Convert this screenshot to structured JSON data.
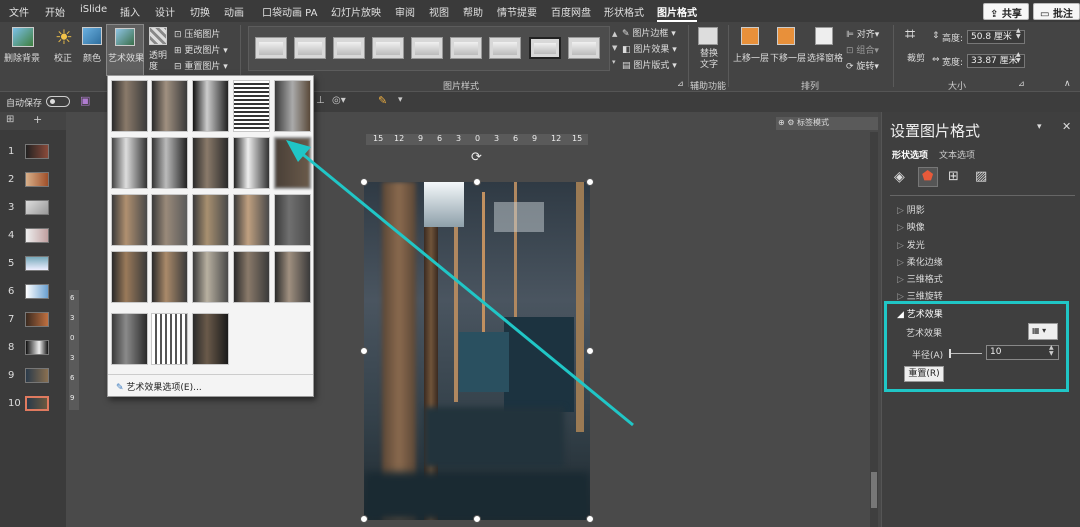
{
  "menubar": {
    "tabs": [
      "文件",
      "开始",
      "iSlide",
      "插入",
      "设计",
      "切换",
      "动画",
      "口袋动画 PA",
      "幻灯片放映",
      "审阅",
      "视图",
      "帮助",
      "情节提要",
      "百度网盘",
      "形状格式",
      "图片格式"
    ],
    "share_label": "共享",
    "comment_label": "批注"
  },
  "ribbon": {
    "remove_bg": "删除背景",
    "correct": "校正",
    "color": "颜色",
    "art_effects": "艺术效果",
    "transparency": "透明度",
    "compress": "压缩图片",
    "change_pic": "更改图片",
    "reset_pic": "重置图片",
    "pic_styles_group": "图片样式",
    "pic_border": "图片边框",
    "pic_effects": "图片效果",
    "pic_layout": "图片版式",
    "alt_text": "替换文字",
    "accessibility_group": "辅助功能",
    "bring_forward": "上移一层",
    "send_backward": "下移一层",
    "selection_pane": "选择窗格",
    "align": "对齐",
    "group": "组合",
    "rotate": "旋转",
    "arrange_group": "排列",
    "crop": "裁剪",
    "height_label": "高度:",
    "height_value": "50.8 厘米",
    "width_label": "宽度:",
    "width_value": "33.87 厘米",
    "size_group": "大小"
  },
  "qat": {
    "autosave": "自动保存"
  },
  "slides": [
    "1",
    "2",
    "3",
    "4",
    "5",
    "6",
    "7",
    "8",
    "9",
    "10"
  ],
  "canvas": {
    "ruler_numbers": [
      "15",
      "12",
      "9",
      "6",
      "3",
      "0",
      "3",
      "6",
      "9",
      "12",
      "15"
    ],
    "vruler_numbers": [
      "6",
      "3",
      "0",
      "3",
      "6",
      "9"
    ],
    "tag_label": "标签模式"
  },
  "pane": {
    "title": "设置图片格式",
    "tab_shape": "形状选项",
    "tab_text": "文本选项",
    "sections": [
      "阴影",
      "映像",
      "发光",
      "柔化边缘",
      "三维格式",
      "三维旋转"
    ],
    "art_section": "艺术效果",
    "art_effect_label": "艺术效果",
    "radius_label": "半径(A)",
    "radius_value": "10",
    "reset_label": "重置(R)"
  },
  "dropdown": {
    "options_label": "艺术效果选项(E)..."
  },
  "colors": {
    "highlight": "#20c6c6",
    "accent": "#e07a5f"
  }
}
